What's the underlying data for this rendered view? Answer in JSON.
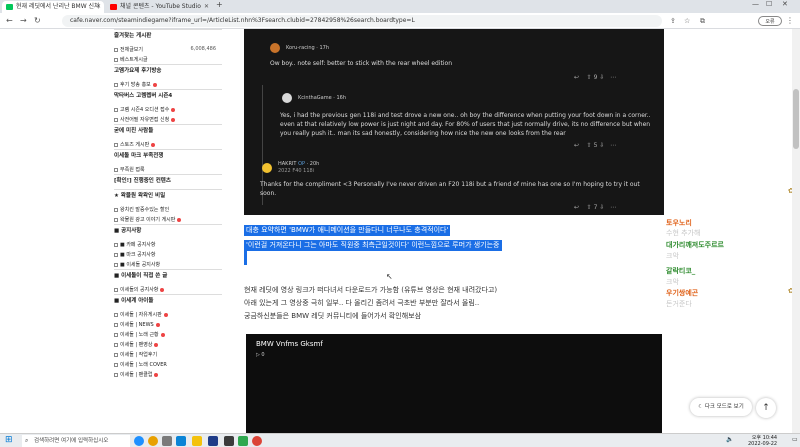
{
  "browser": {
    "tabs": [
      {
        "label": "현재 레딧에서 난리난 BMW 신차",
        "favicon_color": "#03c75a"
      },
      {
        "label": "채널 콘텐츠 - YouTube Studio",
        "favicon_color": "#ff0000"
      }
    ],
    "url": "cafe.naver.com/steamindiegame?iframe_url=/ArticleList.nhn%3Fsearch.clubid=27842958%26search.boardtype=L",
    "new_tab": "+",
    "profile_label": "오류"
  },
  "sidebar": {
    "items": [
      {
        "label": "즐겨찾는 게시판",
        "type": "head",
        "star": "★"
      },
      {
        "label": "전체글보기",
        "count": "6,008,486",
        "type": "item"
      },
      {
        "label": "베스트게시글",
        "type": "item"
      },
      {
        "label": "고멤가요제 후기방송",
        "type": "head"
      },
      {
        "label": "후기 방송 홍보",
        "type": "item",
        "new": true
      },
      {
        "label": "막타버스 고렘렙버 시즌4",
        "type": "head"
      },
      {
        "label": "고렘 시즌4 오디션 접수",
        "type": "item",
        "new": true
      },
      {
        "label": "사전어필 자유면접 신청",
        "type": "item",
        "new": true
      },
      {
        "label": "굳에 미친 사람들",
        "type": "head"
      },
      {
        "label": "스토즈 게시판",
        "type": "item",
        "new": true
      },
      {
        "label": "이세돌 마크 부족전쟁",
        "type": "head"
      },
      {
        "label": "부족원 접룩",
        "type": "item"
      },
      {
        "label": "[확인!] 진행중인 컨텐츠",
        "type": "head"
      },
      {
        "label": "★ 왁물원 왁왁인 비밀",
        "type": "head"
      },
      {
        "label": "왕치킨 발증수있는 할인",
        "type": "item"
      },
      {
        "label": "왁물원 광고 이야기 게시판",
        "type": "item",
        "new": true
      },
      {
        "label": "■ 공지사항",
        "type": "head"
      },
      {
        "label": "■ 카페 공지사항",
        "type": "item"
      },
      {
        "label": "■ 마크 공지사항",
        "type": "item"
      },
      {
        "label": "■ 이세돌 공지사항",
        "type": "item"
      },
      {
        "label": "■ 이세돌이 직접 쓴 글",
        "type": "head"
      },
      {
        "label": "이세돌의 공지사항",
        "type": "item",
        "new": true
      },
      {
        "label": "■ 이세계 아이돌",
        "type": "head"
      },
      {
        "label": "이세돌 | 자유게시판",
        "type": "item",
        "new": true
      },
      {
        "label": "이세돌 | NEWS",
        "type": "item",
        "new": true
      },
      {
        "label": "이세돌 | 노래 근황",
        "type": "item",
        "new": true
      },
      {
        "label": "이세돌 | 팬영상",
        "type": "item",
        "new": true
      },
      {
        "label": "이세돌 | 작업후기",
        "type": "item"
      },
      {
        "label": "이세돌 | 노래 COVER",
        "type": "item"
      },
      {
        "label": "이세돌 | 팬클럽",
        "type": "item",
        "new": true
      }
    ]
  },
  "comments": [
    {
      "user": "Koru-racing",
      "time": "17h",
      "text": "Ow boy.. note self: better to stick with the rear wheel edition",
      "votes": "9",
      "avatar_color": "#c8732a"
    },
    {
      "user": "KcinthaGame",
      "time": "16h",
      "text": "Yes, i had the previous gen 118i and test drove a new one.. oh boy the difference when putting your foot down in a corner.. even at that relatively low power is just night and day. For 80% of users that just normally drive, its no difference but when you really push it.. man its sad honestly, considering how nice the new one looks from the rear",
      "votes": "5",
      "avatar_color": "#d9d9d9"
    },
    {
      "user": "HAKRIT",
      "op": "OP",
      "time": "20h",
      "flair": "2022 F40 118i",
      "text": "Thanks for the compliment <3 Personally I've never driven an F20 118i but a friend of mine has one so I'm hoping to try it out soon.",
      "votes": "7",
      "avatar_color": "#f2c230"
    }
  ],
  "article": {
    "highlight_lines": [
      "대충 요약하면 'BMW가 애니메이션을 만들다니 너무나도 충격적이다'",
      "'이런걸 거져온다니 그는 아마도 직원중 최측근일것이다' 이런느낌으로 루머가 생기는중"
    ],
    "paragraphs": [
      "현재 레딧에 영상 링크가 떠다녀서 다운로드가 가능함 (유튜브 영상은 현재 내려갔다고)",
      "아래 있는게 그 영상중 극히 일부.. 다 올리긴 좀려서 극초반 부분만 잘라서 올림..",
      "궁금하신분들은 BMW 레딧 커뮤니티에 들어가서 확인해보삼"
    ],
    "video_title": "BMW Vnfms Gksmf",
    "video_sub": "▷ 0"
  },
  "chat": [
    {
      "name": "토우노리",
      "sub": "수현 추가해",
      "color": "#e0651e"
    },
    {
      "name": "대가리깨져도주르르",
      "sub": "크악",
      "color": "#2e8b2e"
    },
    {
      "name": "갈락티코_",
      "sub": "크악",
      "color": "#2e8b2e"
    },
    {
      "name": "우기쌍예곤",
      "sub": "돈거준다",
      "color": "#e0651e"
    }
  ],
  "ui": {
    "dark_mode_label": "다크 모드로 보기",
    "scroll_top": "↑"
  },
  "taskbar": {
    "search_placeholder": "검색하려면 여기에 입력하십시오",
    "time": "오후 10:44",
    "date": "2022-09-22"
  }
}
